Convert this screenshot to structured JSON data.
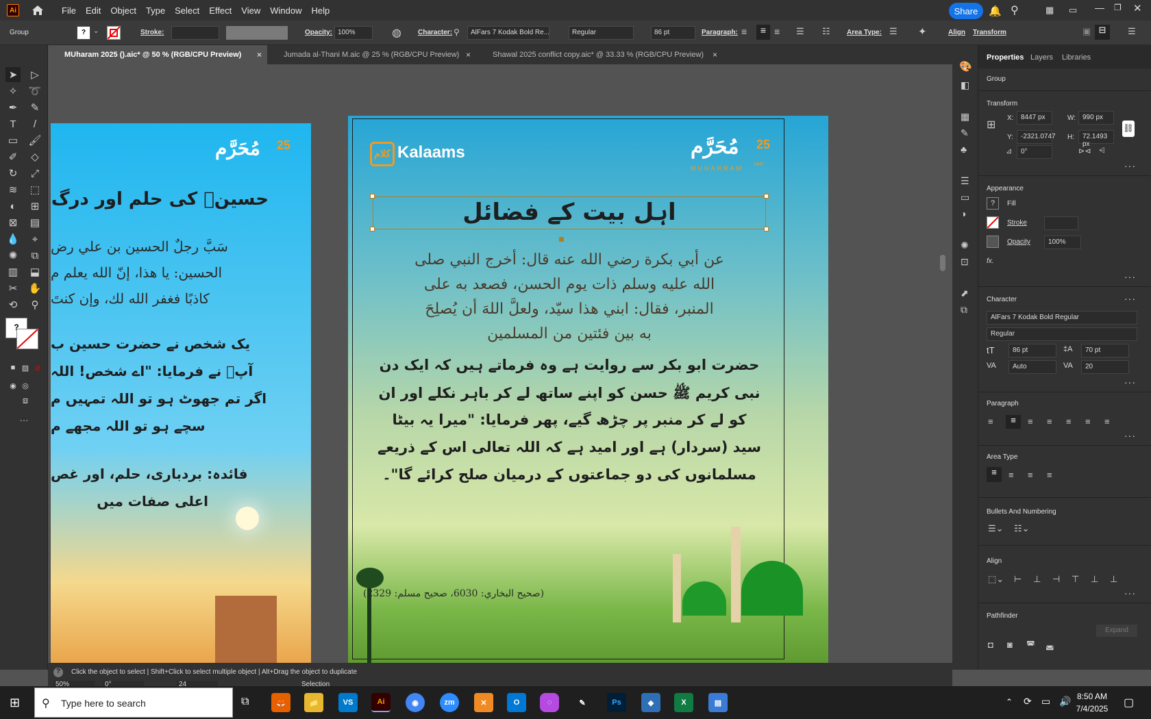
{
  "app": {
    "logo": "Ai",
    "home_icon": "home-icon"
  },
  "menu": [
    "File",
    "Edit",
    "Object",
    "Type",
    "Select",
    "Effect",
    "View",
    "Window",
    "Help"
  ],
  "share_label": "Share",
  "control_bar": {
    "selection": "Group",
    "fill_value": "?",
    "stroke_label": "Stroke:",
    "opacity_label": "Opacity:",
    "opacity_value": "100%",
    "character_label": "Character:",
    "font_name": "AlFars 7 Kodak Bold Re...",
    "font_style": "Regular",
    "font_size": "86 pt",
    "paragraph_label": "Paragraph:",
    "area_type_label": "Area Type:",
    "align_label": "Align",
    "transform_label": "Transform"
  },
  "tabs": [
    {
      "label": "MUharam 2025 ().aic* @ 50 % (RGB/CPU Preview)",
      "close": "×"
    },
    {
      "label": "Jumada al-Thani M.aic @ 25 % (RGB/CPU Preview)",
      "close": "×"
    },
    {
      "label": "Shawal 2025 conflict copy.aic* @ 33.33 % (RGB/CPU Preview)",
      "close": "×"
    }
  ],
  "panel": {
    "tabs": [
      "Properties",
      "Layers",
      "Libraries"
    ],
    "group_label": "Group",
    "transform": {
      "title": "Transform",
      "x_label": "X:",
      "x": "8447 px",
      "y_label": "Y:",
      "y": "-2321.0747",
      "w_label": "W:",
      "w": "990 px",
      "h_label": "H:",
      "h": "72.1493 px",
      "angle": "0°"
    },
    "appearance": {
      "title": "Appearance",
      "fill_label": "Fill",
      "fill_icon": "?",
      "stroke_label": "Stroke",
      "opacity_label": "Opacity",
      "opacity_value": "100%",
      "fx": "fx."
    },
    "character": {
      "title": "Character",
      "font": "AlFars 7 Kodak Bold Regular",
      "style": "Regular",
      "size": "86 pt",
      "leading": "70 pt",
      "kerning": "Auto",
      "tracking": "20"
    },
    "paragraph_title": "Paragraph",
    "area_type_title": "Area Type",
    "bullets_title": "Bullets And Numbering",
    "align_title": "Align",
    "pathfinder_title": "Pathfinder",
    "expand_label": "Expand"
  },
  "status": {
    "hint": "Click the object to select  |  Shift+Click to select multiple object  |  Alt+Drag the object to duplicate",
    "zoom": "50%",
    "rotation": "0°",
    "artboard": "24",
    "mode": "Selection"
  },
  "artwork": {
    "brand": "Kalaams",
    "brand_mark": "كلام",
    "muharram_ar": "مُحَرَّم",
    "muharram_num": "25",
    "muharram_en": "MUHARRAM",
    "muharram_year": "1447",
    "main_title": "اہل بیت کے فضائل",
    "arabic_hadith": [
      "عن أبي بكرة رضي الله عنه قال: أخرج النبي صلى",
      "الله عليه وسلم ذات يوم الحسن، فصعد به على",
      "المنبر، فقال: ابني هذا سيّد، ولعلَّ اللهَ أن يُصلِحَ",
      "به بين فئتين من المسلمين"
    ],
    "urdu_translation": [
      "حضرت ابو بکر سے روایت ہے وہ فرماتے ہیں کہ ایک دن",
      "نبی کریم ﷺ حسن کو اپنے ساتھ لے کر باہر نکلے اور ان",
      "کو لے کر منبر پر چڑھ گیے، پھر فرمایا: \"میرا یہ بیٹا",
      "سید (سردار) ہے اور امید ہے کہ اللہ تعالی اس کے ذریعے",
      "مسلمانوں کی دو جماعتوں کے درمیان صلح کرائے گا\"۔"
    ],
    "reference": "(صحيح البخاري: 6030، صحيح مسلم: 2329)",
    "left_title": "حسینؓ کی حلم اور درگ",
    "left_arabic": [
      "سَبَّ رجلٌ الحسين بن علي رض",
      "الحسين: يا هذا، إنّ الله يعلم م",
      "كاذبًا فغفر الله لك، وإن كنتَ"
    ],
    "left_urdu": [
      "یک شخص نے حضرت حسین ب",
      "آپؓ نے فرمایا: \"اے شخص! اللہ",
      "اگر تم جھوٹ ہو تو اللہ تمہیں م",
      "سچے ہو تو اللہ مجھے م"
    ],
    "left_note": [
      "فائدہ: بردباری، حلم، اور غص",
      "اعلی صفات میں"
    ]
  },
  "taskbar": {
    "search_placeholder": "Type here to search",
    "time": "8:50 AM",
    "date": "7/4/2025"
  }
}
